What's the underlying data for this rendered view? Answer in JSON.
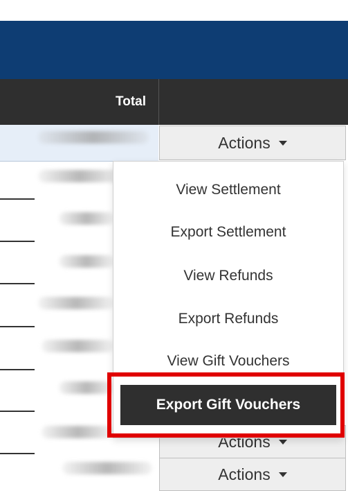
{
  "table": {
    "header_total": "Total",
    "actions_label": "Actions"
  },
  "dropdown": {
    "items": [
      "View Settlement",
      "Export Settlement",
      "View Refunds",
      "Export Refunds",
      "View Gift Vouchers",
      "Export Gift Vouchers"
    ]
  },
  "colors": {
    "banner": "#0e3d73",
    "header": "#2f2f2f",
    "highlight": "#e00000"
  }
}
